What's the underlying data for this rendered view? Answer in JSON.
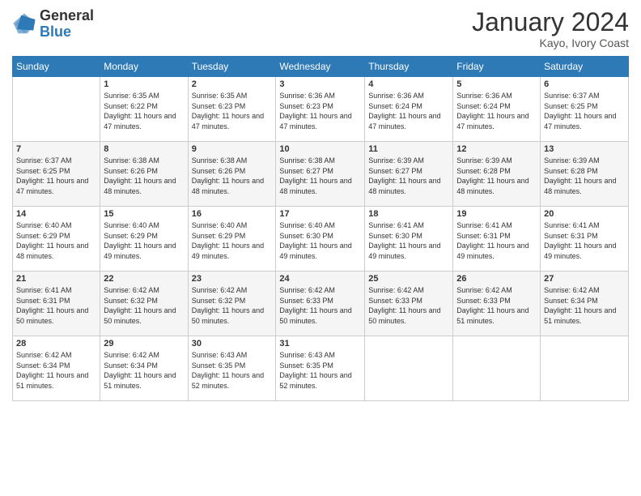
{
  "header": {
    "logo_general": "General",
    "logo_blue": "Blue",
    "month_title": "January 2024",
    "location": "Kayo, Ivory Coast"
  },
  "weekdays": [
    "Sunday",
    "Monday",
    "Tuesday",
    "Wednesday",
    "Thursday",
    "Friday",
    "Saturday"
  ],
  "weeks": [
    [
      {
        "day": "",
        "sunrise": "",
        "sunset": "",
        "daylight": ""
      },
      {
        "day": "1",
        "sunrise": "Sunrise: 6:35 AM",
        "sunset": "Sunset: 6:22 PM",
        "daylight": "Daylight: 11 hours and 47 minutes."
      },
      {
        "day": "2",
        "sunrise": "Sunrise: 6:35 AM",
        "sunset": "Sunset: 6:23 PM",
        "daylight": "Daylight: 11 hours and 47 minutes."
      },
      {
        "day": "3",
        "sunrise": "Sunrise: 6:36 AM",
        "sunset": "Sunset: 6:23 PM",
        "daylight": "Daylight: 11 hours and 47 minutes."
      },
      {
        "day": "4",
        "sunrise": "Sunrise: 6:36 AM",
        "sunset": "Sunset: 6:24 PM",
        "daylight": "Daylight: 11 hours and 47 minutes."
      },
      {
        "day": "5",
        "sunrise": "Sunrise: 6:36 AM",
        "sunset": "Sunset: 6:24 PM",
        "daylight": "Daylight: 11 hours and 47 minutes."
      },
      {
        "day": "6",
        "sunrise": "Sunrise: 6:37 AM",
        "sunset": "Sunset: 6:25 PM",
        "daylight": "Daylight: 11 hours and 47 minutes."
      }
    ],
    [
      {
        "day": "7",
        "sunrise": "Sunrise: 6:37 AM",
        "sunset": "Sunset: 6:25 PM",
        "daylight": "Daylight: 11 hours and 47 minutes."
      },
      {
        "day": "8",
        "sunrise": "Sunrise: 6:38 AM",
        "sunset": "Sunset: 6:26 PM",
        "daylight": "Daylight: 11 hours and 48 minutes."
      },
      {
        "day": "9",
        "sunrise": "Sunrise: 6:38 AM",
        "sunset": "Sunset: 6:26 PM",
        "daylight": "Daylight: 11 hours and 48 minutes."
      },
      {
        "day": "10",
        "sunrise": "Sunrise: 6:38 AM",
        "sunset": "Sunset: 6:27 PM",
        "daylight": "Daylight: 11 hours and 48 minutes."
      },
      {
        "day": "11",
        "sunrise": "Sunrise: 6:39 AM",
        "sunset": "Sunset: 6:27 PM",
        "daylight": "Daylight: 11 hours and 48 minutes."
      },
      {
        "day": "12",
        "sunrise": "Sunrise: 6:39 AM",
        "sunset": "Sunset: 6:28 PM",
        "daylight": "Daylight: 11 hours and 48 minutes."
      },
      {
        "day": "13",
        "sunrise": "Sunrise: 6:39 AM",
        "sunset": "Sunset: 6:28 PM",
        "daylight": "Daylight: 11 hours and 48 minutes."
      }
    ],
    [
      {
        "day": "14",
        "sunrise": "Sunrise: 6:40 AM",
        "sunset": "Sunset: 6:29 PM",
        "daylight": "Daylight: 11 hours and 48 minutes."
      },
      {
        "day": "15",
        "sunrise": "Sunrise: 6:40 AM",
        "sunset": "Sunset: 6:29 PM",
        "daylight": "Daylight: 11 hours and 49 minutes."
      },
      {
        "day": "16",
        "sunrise": "Sunrise: 6:40 AM",
        "sunset": "Sunset: 6:29 PM",
        "daylight": "Daylight: 11 hours and 49 minutes."
      },
      {
        "day": "17",
        "sunrise": "Sunrise: 6:40 AM",
        "sunset": "Sunset: 6:30 PM",
        "daylight": "Daylight: 11 hours and 49 minutes."
      },
      {
        "day": "18",
        "sunrise": "Sunrise: 6:41 AM",
        "sunset": "Sunset: 6:30 PM",
        "daylight": "Daylight: 11 hours and 49 minutes."
      },
      {
        "day": "19",
        "sunrise": "Sunrise: 6:41 AM",
        "sunset": "Sunset: 6:31 PM",
        "daylight": "Daylight: 11 hours and 49 minutes."
      },
      {
        "day": "20",
        "sunrise": "Sunrise: 6:41 AM",
        "sunset": "Sunset: 6:31 PM",
        "daylight": "Daylight: 11 hours and 49 minutes."
      }
    ],
    [
      {
        "day": "21",
        "sunrise": "Sunrise: 6:41 AM",
        "sunset": "Sunset: 6:31 PM",
        "daylight": "Daylight: 11 hours and 50 minutes."
      },
      {
        "day": "22",
        "sunrise": "Sunrise: 6:42 AM",
        "sunset": "Sunset: 6:32 PM",
        "daylight": "Daylight: 11 hours and 50 minutes."
      },
      {
        "day": "23",
        "sunrise": "Sunrise: 6:42 AM",
        "sunset": "Sunset: 6:32 PM",
        "daylight": "Daylight: 11 hours and 50 minutes."
      },
      {
        "day": "24",
        "sunrise": "Sunrise: 6:42 AM",
        "sunset": "Sunset: 6:33 PM",
        "daylight": "Daylight: 11 hours and 50 minutes."
      },
      {
        "day": "25",
        "sunrise": "Sunrise: 6:42 AM",
        "sunset": "Sunset: 6:33 PM",
        "daylight": "Daylight: 11 hours and 50 minutes."
      },
      {
        "day": "26",
        "sunrise": "Sunrise: 6:42 AM",
        "sunset": "Sunset: 6:33 PM",
        "daylight": "Daylight: 11 hours and 51 minutes."
      },
      {
        "day": "27",
        "sunrise": "Sunrise: 6:42 AM",
        "sunset": "Sunset: 6:34 PM",
        "daylight": "Daylight: 11 hours and 51 minutes."
      }
    ],
    [
      {
        "day": "28",
        "sunrise": "Sunrise: 6:42 AM",
        "sunset": "Sunset: 6:34 PM",
        "daylight": "Daylight: 11 hours and 51 minutes."
      },
      {
        "day": "29",
        "sunrise": "Sunrise: 6:42 AM",
        "sunset": "Sunset: 6:34 PM",
        "daylight": "Daylight: 11 hours and 51 minutes."
      },
      {
        "day": "30",
        "sunrise": "Sunrise: 6:43 AM",
        "sunset": "Sunset: 6:35 PM",
        "daylight": "Daylight: 11 hours and 52 minutes."
      },
      {
        "day": "31",
        "sunrise": "Sunrise: 6:43 AM",
        "sunset": "Sunset: 6:35 PM",
        "daylight": "Daylight: 11 hours and 52 minutes."
      },
      {
        "day": "",
        "sunrise": "",
        "sunset": "",
        "daylight": ""
      },
      {
        "day": "",
        "sunrise": "",
        "sunset": "",
        "daylight": ""
      },
      {
        "day": "",
        "sunrise": "",
        "sunset": "",
        "daylight": ""
      }
    ]
  ]
}
